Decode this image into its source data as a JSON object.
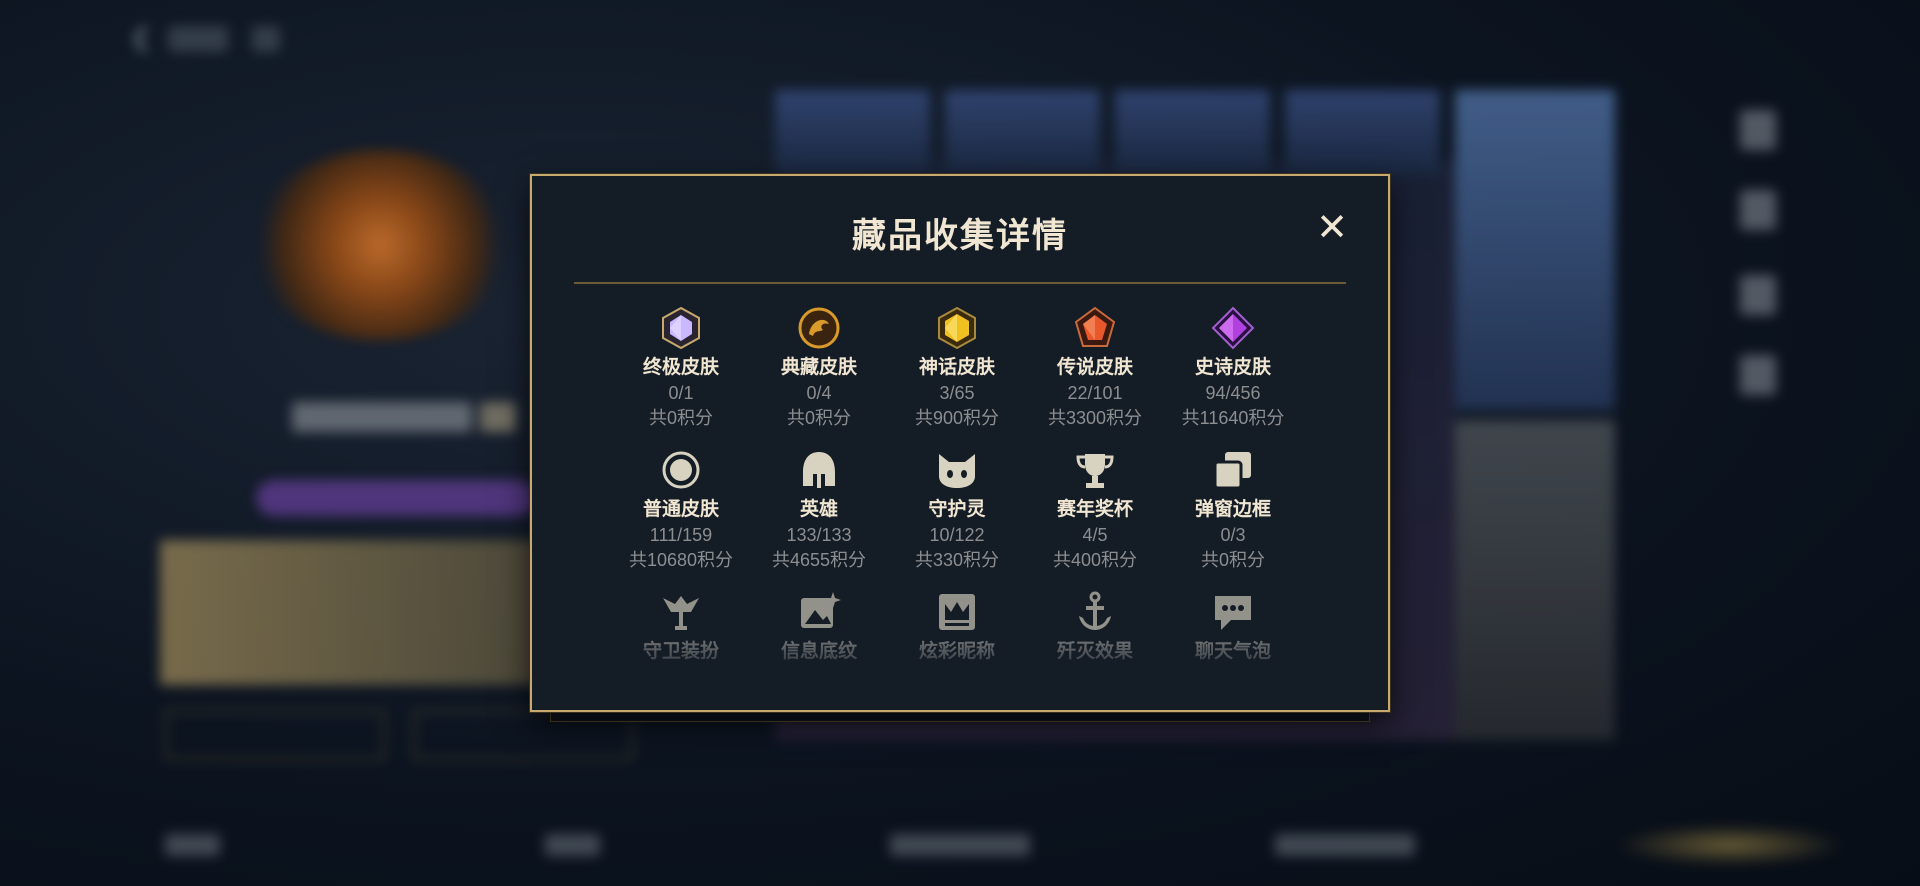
{
  "modal": {
    "title": "藏品收集详情",
    "close_label": "✕"
  },
  "categories": [
    {
      "name": "终极皮肤",
      "count": "0/1",
      "points": "共0积分",
      "icon": "ultimate-gem-icon",
      "color": "#c9b8ff"
    },
    {
      "name": "典藏皮肤",
      "count": "0/4",
      "points": "共0积分",
      "icon": "prestige-dragon-icon",
      "color": "#d89a2a"
    },
    {
      "name": "神话皮肤",
      "count": "3/65",
      "points": "共900积分",
      "icon": "mythic-gem-icon",
      "color": "#f0c020"
    },
    {
      "name": "传说皮肤",
      "count": "22/101",
      "points": "共3300积分",
      "icon": "legendary-gem-icon",
      "color": "#e8582a"
    },
    {
      "name": "史诗皮肤",
      "count": "94/456",
      "points": "共11640积分",
      "icon": "epic-gem-icon",
      "color": "#b040e0"
    },
    {
      "name": "普通皮肤",
      "count": "111/159",
      "points": "共10680积分",
      "icon": "circle-icon",
      "color": "#d8d2c0"
    },
    {
      "name": "英雄",
      "count": "133/133",
      "points": "共4655积分",
      "icon": "helmet-icon",
      "color": "#d8d2c0"
    },
    {
      "name": "守护灵",
      "count": "10/122",
      "points": "共330积分",
      "icon": "cat-face-icon",
      "color": "#d8d2c0"
    },
    {
      "name": "赛年奖杯",
      "count": "4/5",
      "points": "共400积分",
      "icon": "trophy-icon",
      "color": "#d8d2c0"
    },
    {
      "name": "弹窗边框",
      "count": "0/3",
      "points": "共0积分",
      "icon": "frames-icon",
      "color": "#d8d2c0"
    },
    {
      "name": "守卫装扮",
      "count": "",
      "points": "",
      "icon": "ward-icon",
      "color": "#d8d2c0"
    },
    {
      "name": "信息底纹",
      "count": "",
      "points": "",
      "icon": "image-sparkle-icon",
      "color": "#d8d2c0"
    },
    {
      "name": "炫彩昵称",
      "count": "",
      "points": "",
      "icon": "crown-card-icon",
      "color": "#d8d2c0"
    },
    {
      "name": "歼灭效果",
      "count": "",
      "points": "",
      "icon": "anchor-icon",
      "color": "#d8d2c0"
    },
    {
      "name": "聊天气泡",
      "count": "",
      "points": "",
      "icon": "chat-bubble-icon",
      "color": "#d8d2c0"
    }
  ]
}
